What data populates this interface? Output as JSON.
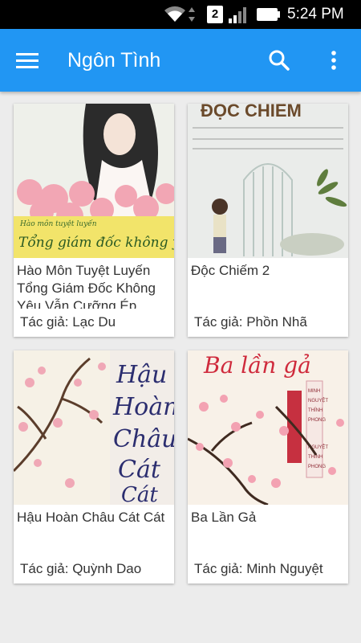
{
  "status_bar": {
    "sim_slot": "2",
    "time": "5:24 PM",
    "icons": [
      "wifi-icon",
      "data-arrows-icon",
      "sim-icon",
      "signal-icon",
      "battery-icon"
    ]
  },
  "app_bar": {
    "title": "Ngôn Tình",
    "icons": [
      "menu-icon",
      "search-icon",
      "more-vert-icon"
    ]
  },
  "books": [
    {
      "title": "Hào Môn Tuyệt Luyến Tổng Giám Đốc Không Yêu Vẫn Cưỡng Ép",
      "author": "Tác giả: Lạc Du",
      "cover_text": "Tổng giám đốc không yêu"
    },
    {
      "title": "Độc Chiếm 2",
      "author": "Tác giả: Phồn Nhã",
      "cover_text": "ĐỘC CHIẾM"
    },
    {
      "title": "Hậu Hoàn Châu Cát Cát",
      "author": "Tác giả: Quỳnh Dao",
      "cover_text": "Hậu Hoàn Châu Cát Cát"
    },
    {
      "title": "Ba Lần Gả",
      "author": "Tác giả: Minh Nguyệt",
      "cover_text": "Ba lần gả"
    }
  ],
  "colors": {
    "app_bar": "#2196f3",
    "status_bar": "#000000",
    "background": "#ececec",
    "card": "#ffffff"
  }
}
